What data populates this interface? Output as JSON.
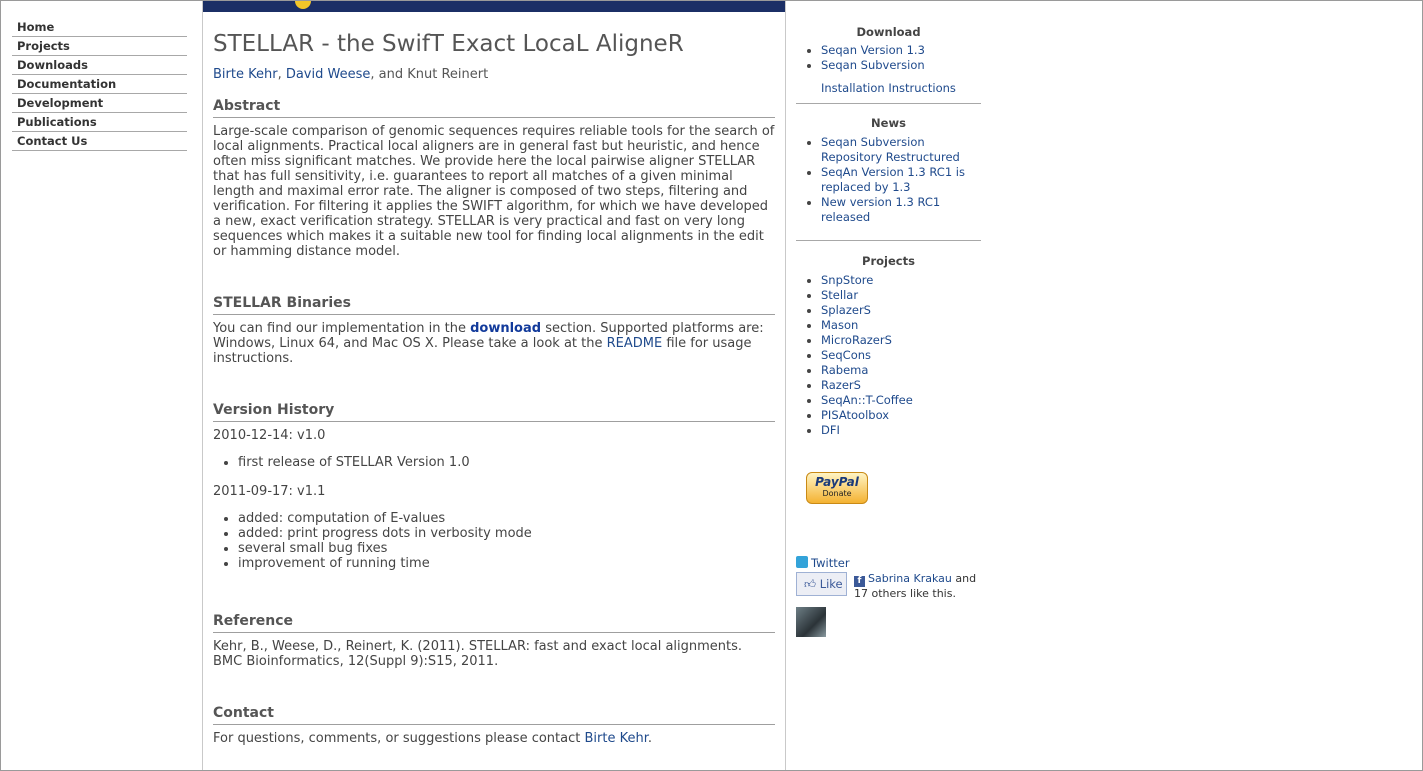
{
  "nav": {
    "items": [
      {
        "label": "Home"
      },
      {
        "label": "Projects"
      },
      {
        "label": "Downloads"
      },
      {
        "label": "Documentation"
      },
      {
        "label": "Development"
      },
      {
        "label": "Publications"
      },
      {
        "label": "Contact Us"
      }
    ]
  },
  "main": {
    "title": "STELLAR - the SwifT Exact LocaL AligneR",
    "authors": {
      "author1": "Birte Kehr",
      "sep1": ", ",
      "author2": "David Weese",
      "rest": ", and Knut Reinert"
    },
    "abstract": {
      "heading": "Abstract",
      "text": "Large-scale comparison of genomic sequences requires reliable tools for the search of local alignments. Practical local aligners are in general fast but heuristic, and hence often miss significant matches. We provide here the local pairwise aligner STELLAR that has full sensitivity, i.e. guarantees to report all matches of a given minimal length and maximal error rate. The aligner is composed of two steps, filtering and verification. For filtering it applies the SWIFT algorithm, for which we have developed a new, exact verification strategy. STELLAR is very practical and fast on very long sequences which makes it a suitable new tool for finding local alignments in the edit or hamming distance model."
    },
    "binaries": {
      "heading": "STELLAR Binaries",
      "text1": "You can find our implementation in the ",
      "download_link": "download",
      "text2": " section. Supported platforms are: Windows, Linux 64, and Mac OS X. Please take a look at the ",
      "readme_link": "README",
      "text3": " file for usage instructions."
    },
    "history": {
      "heading": "Version History",
      "v1_date": "2010-12-14: v1.0",
      "v1_items": [
        "first release of STELLAR Version 1.0"
      ],
      "v2_date": "2011-09-17: v1.1",
      "v2_items": [
        "added: computation of E-values",
        "added: print progress dots in verbosity mode",
        "several small bug fixes",
        "improvement of running time"
      ]
    },
    "reference": {
      "heading": "Reference",
      "text": "Kehr, B., Weese, D., Reinert, K. (2011). STELLAR: fast and exact local alignments. BMC Bioinformatics, 12(Suppl 9):S15, 2011."
    },
    "contact": {
      "heading": "Contact",
      "text": "For questions, comments, or suggestions please contact ",
      "link": "Birte Kehr",
      "end": "."
    }
  },
  "sidebar": {
    "download": {
      "heading": "Download",
      "items": [
        "Seqan Version 1.3",
        "Seqan Subversion"
      ],
      "install": "Installation Instructions"
    },
    "news": {
      "heading": "News",
      "items": [
        "Seqan Subversion Repository Restructured",
        "SeqAn Version 1.3 RC1 is replaced by 1.3",
        "New version 1.3 RC1 released"
      ]
    },
    "projects": {
      "heading": "Projects",
      "items": [
        "SnpStore",
        "Stellar",
        "SplazerS",
        "Mason",
        "MicroRazerS",
        "SeqCons",
        "Rabema",
        "RazerS",
        "SeqAn::T-Coffee",
        "PISAtoolbox",
        "DFI"
      ]
    },
    "paypal": {
      "brand": "PayPal",
      "label": "Donate"
    },
    "twitter": "Twitter",
    "like": "Like",
    "fb_name": "Sabrina Krakau",
    "fb_text": " and 17 others like this."
  }
}
